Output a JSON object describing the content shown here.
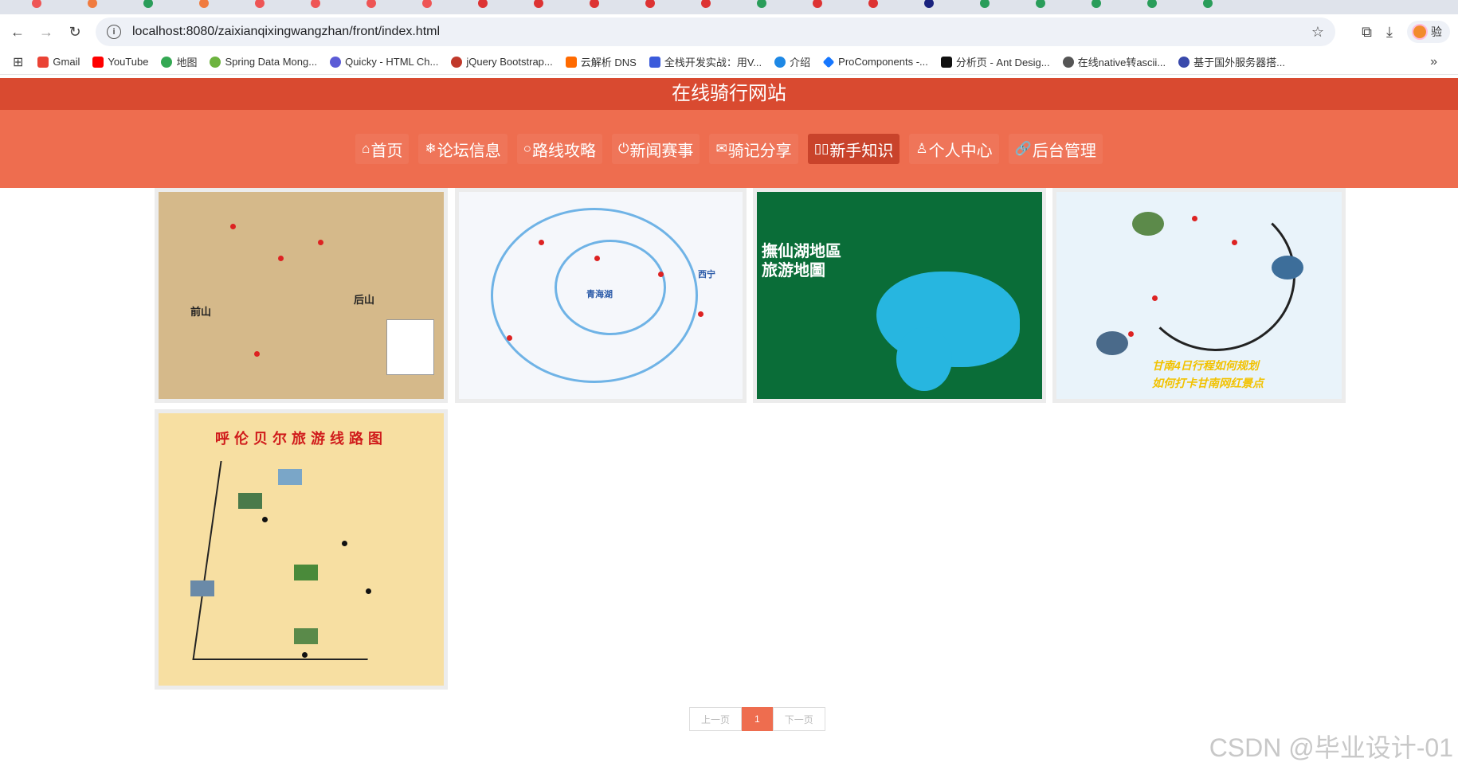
{
  "browser": {
    "url": "localhost:8080/zaixianqixingwangzhan/front/index.html",
    "bookmarks": [
      {
        "label": "Gmail",
        "color": "#ea4335"
      },
      {
        "label": "YouTube",
        "color": "#ff0000"
      },
      {
        "label": "地图",
        "color": "#34a853"
      },
      {
        "label": "Spring Data Mong...",
        "color": "#6db33f"
      },
      {
        "label": "Quicky - HTML Ch...",
        "color": "#5b5bd6"
      },
      {
        "label": "jQuery Bootstrap...",
        "color": "#c0392b"
      },
      {
        "label": "云解析 DNS",
        "color": "#ff6a00"
      },
      {
        "label": "全栈开发实战：用V...",
        "color": "#3b5bdb"
      },
      {
        "label": "介绍",
        "color": "#1e88e5"
      },
      {
        "label": "ProComponents -...",
        "color": "#1677ff"
      },
      {
        "label": "分析页 - Ant Desig...",
        "color": "#111111"
      },
      {
        "label": "在线native转ascii...",
        "color": "#555555"
      },
      {
        "label": "基于国外服务器搭...",
        "color": "#3949ab"
      }
    ],
    "profile_label": "验"
  },
  "site": {
    "title": "在线骑行网站",
    "nav": [
      {
        "glyph": "⌂",
        "label": "首页"
      },
      {
        "glyph": "❄",
        "label": "论坛信息"
      },
      {
        "glyph": "○",
        "label": "路线攻略"
      },
      {
        "glyph": "⏻",
        "label": "新闻赛事"
      },
      {
        "glyph": "✉",
        "label": "骑记分享"
      },
      {
        "glyph": "▯▯",
        "label": "新手知识"
      },
      {
        "glyph": "♙",
        "label": "个人中心"
      },
      {
        "glyph": "🔗",
        "label": "后台管理"
      }
    ],
    "active_nav": "新手知识",
    "cards": [
      {
        "map_text_1": "前山",
        "map_text_2": "后山"
      },
      {
        "map_text_1": "青海湖",
        "map_text_2": "西宁"
      },
      {
        "map_text_1": "撫仙湖地區",
        "map_text_2": "旅游地圖"
      },
      {
        "map_text_1": "甘南4日行程如何规划",
        "map_text_2": "如何打卡甘南网红景点"
      },
      {
        "map_text_1": "呼伦贝尔旅游线路图",
        "map_text_2": ""
      }
    ],
    "pager": {
      "prev": "上一页",
      "current": "1",
      "next": "下一页"
    }
  },
  "watermark": "CSDN @毕业设计-01"
}
